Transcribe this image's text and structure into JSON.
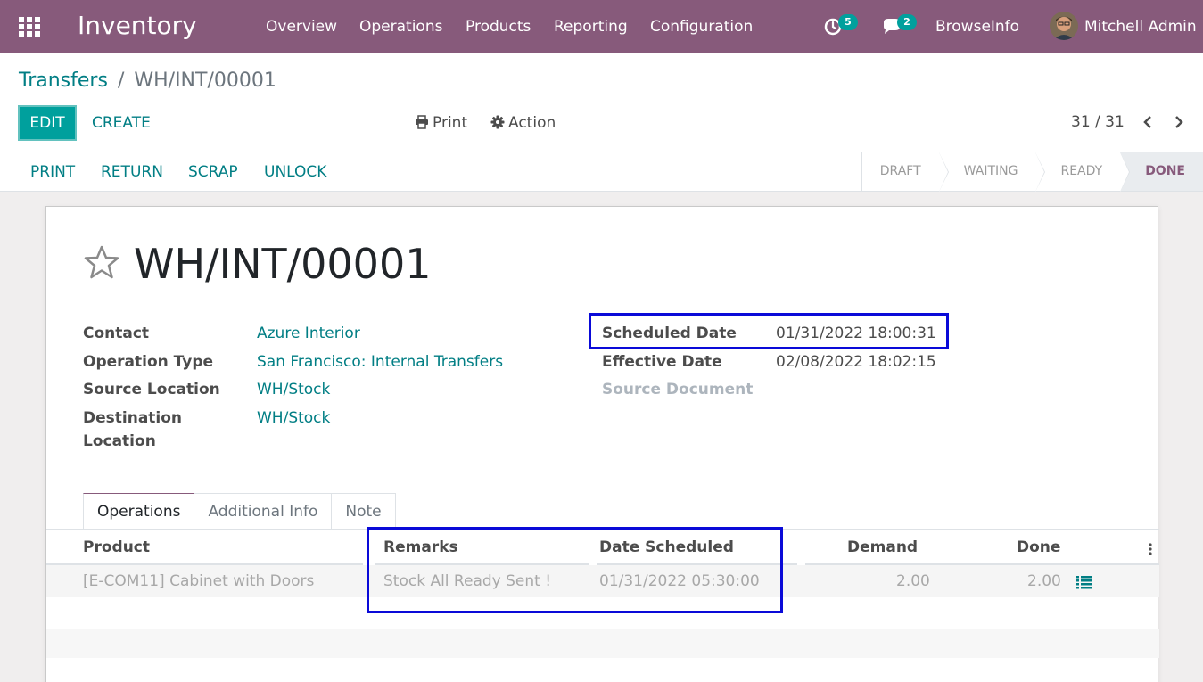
{
  "navbar": {
    "app_name": "Inventory",
    "menu": [
      "Overview",
      "Operations",
      "Products",
      "Reporting",
      "Configuration"
    ],
    "activity_count": "5",
    "message_count": "2",
    "company": "BrowseInfo",
    "user": "Mitchell Admin",
    "color": "#875a7b"
  },
  "breadcrumb": {
    "parent": "Transfers",
    "separator": "/",
    "current": "WH/INT/00001"
  },
  "control": {
    "edit_label": "EDIT",
    "create_label": "CREATE",
    "print_label": "Print",
    "action_label": "Action",
    "pager": "31 / 31"
  },
  "statusbar": {
    "buttons": [
      "PRINT",
      "RETURN",
      "SCRAP",
      "UNLOCK"
    ],
    "stages": [
      {
        "label": "DRAFT",
        "active": false
      },
      {
        "label": "WAITING",
        "active": false
      },
      {
        "label": "READY",
        "active": false
      },
      {
        "label": "DONE",
        "active": true
      }
    ]
  },
  "record": {
    "title": "WH/INT/00001",
    "left_fields": [
      {
        "label": "Contact",
        "value": "Azure Interior"
      },
      {
        "label": "Operation Type",
        "value": "San Francisco: Internal Transfers"
      },
      {
        "label": "Source Location",
        "value": "WH/Stock"
      },
      {
        "label": "Destination Location",
        "value": "WH/Stock"
      }
    ],
    "right_fields": [
      {
        "label": "Scheduled Date",
        "value": "01/31/2022 18:00:31"
      },
      {
        "label": "Effective Date",
        "value": "02/08/2022 18:02:15"
      },
      {
        "label": "Source Document",
        "value": ""
      }
    ]
  },
  "tabs": [
    "Operations",
    "Additional Info",
    "Note"
  ],
  "table": {
    "columns": [
      "Product",
      "Remarks",
      "Date Scheduled",
      "Demand",
      "Done"
    ],
    "rows": [
      {
        "product": "[E-COM11] Cabinet with Doors",
        "remarks": "Stock All Ready Sent !",
        "date_scheduled": "01/31/2022 05:30:00",
        "demand": "2.00",
        "done": "2.00"
      }
    ]
  },
  "colors": {
    "accent": "#00a09d",
    "link": "#017e84",
    "highlight": "#0a0ad8"
  }
}
